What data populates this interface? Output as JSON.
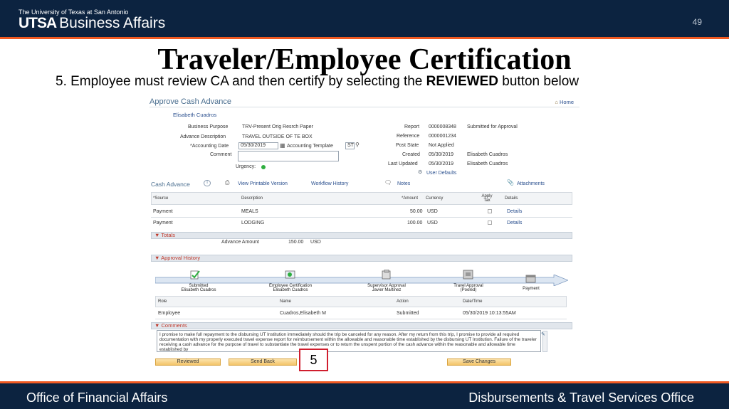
{
  "header": {
    "university": "The University of Texas at San Antonio",
    "logo_bold": "UTSA",
    "logo_text": "Business Affairs",
    "page_number": "49"
  },
  "slide": {
    "title": "Traveler/Employee Certification",
    "instruction_pre": "5. Employee must review CA and then certify by selecting the ",
    "instruction_bold": "REVIEWED",
    "instruction_post": " button below",
    "callout": "5"
  },
  "footer": {
    "left": "Office of Financial Affairs",
    "right": "Disbursements & Travel Services Office"
  },
  "app": {
    "page_title": "Approve Cash Advance",
    "home_link": "Home",
    "employee": "Elisabeth Cuadros",
    "fields": {
      "business_purpose_label": "Business Purpose",
      "business_purpose_value": "TRV-Present Orig Resrch Paper",
      "advance_description_label": "Advance Description",
      "advance_description_value": "TRAVEL OUTSIDE OF TE BOX",
      "accounting_date_label": "*Accounting Date",
      "accounting_date_value": "05/30/2019",
      "accounting_template_label": "Accounting Template",
      "accounting_template_value": "ST",
      "comment_label": "Comment",
      "urgency_label": "Urgency:",
      "report_label": "Report",
      "report_value": "0000008348",
      "report_status": "Submitted for Approval",
      "reference_label": "Reference",
      "reference_value": "0000001234",
      "post_state_label": "Post State",
      "post_state_value": "Not Applied",
      "created_label": "Created",
      "created_date": "05/30/2019",
      "created_by": "Elisabeth Cuadros",
      "last_updated_label": "Last Updated",
      "last_updated_date": "05/30/2019",
      "last_updated_by": "Elisabeth Cuadros",
      "user_defaults": "User Defaults"
    },
    "cash_advance": {
      "label": "Cash Advance",
      "printable": "View Printable Version",
      "workflow": "Workflow History",
      "notes": "Notes",
      "attachments": "Attachments",
      "columns": [
        "*Source",
        "Description",
        "*Amount",
        "Currency",
        "Apply Tax",
        "Details"
      ],
      "rows": [
        {
          "source": "Payment",
          "description": "MEALS",
          "amount": "50.00",
          "currency": "USD",
          "details": "Details"
        },
        {
          "source": "Payment",
          "description": "LODGING",
          "amount": "100.00",
          "currency": "USD",
          "details": "Details"
        }
      ]
    },
    "totals": {
      "label": "Totals",
      "advance_amount_label": "Advance Amount",
      "advance_amount_value": "150.00",
      "advance_amount_currency": "USD"
    },
    "approval_history": {
      "label": "Approval History",
      "steps": [
        {
          "title": "Submitted",
          "name": "Elisabeth Cuadros"
        },
        {
          "title": "Employee Certification",
          "name": "Elisabeth Cuadros"
        },
        {
          "title": "Supervisor Approval",
          "name": "Javier Martinez"
        },
        {
          "title": "Travel Approval",
          "name": "(Pooled)"
        },
        {
          "title": "Payment",
          "name": ""
        }
      ],
      "columns": [
        "Role",
        "Name",
        "Action",
        "Date/Time"
      ],
      "rows": [
        {
          "role": "Employee",
          "name": "Cuadros,Elisabeth M",
          "action": "Submitted",
          "datetime": "05/30/2019 10:13:55AM"
        }
      ]
    },
    "comments": {
      "label": "Comments",
      "text": "I promise to make full repayment to the disbursing UT Institution immediately should the trip be canceled for any reason.  After my return from this trip, I promise to provide all required documentation with my properly executed travel expense report for reimbursement within the allowable and reasonable time established by the disbursing UT Institution. Failure of the traveler receiving a cash advance for the purpose of travel to substantiate the travel expenses or to return the unspent portion of the cash advance within the reasonable and allowable time established by"
    },
    "buttons": {
      "reviewed": "Reviewed",
      "send_back": "Send Back",
      "save_changes": "Save Changes"
    }
  },
  "colors": {
    "navy": "#0c2340",
    "orange": "#f15a22",
    "callout_red": "#d01e2e",
    "link_blue": "#2a4f8e"
  }
}
